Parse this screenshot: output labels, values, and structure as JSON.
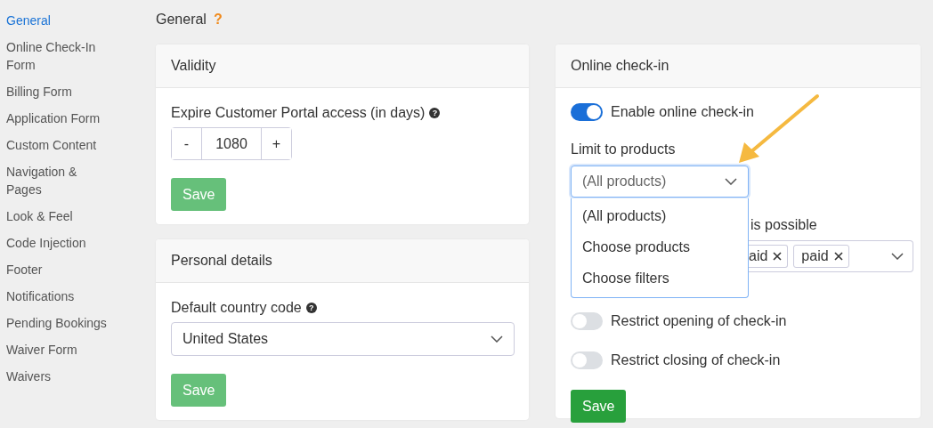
{
  "sidebar": {
    "items": [
      {
        "label": "General",
        "selected": true
      },
      {
        "label": "Online Check-In Form",
        "selected": false
      },
      {
        "label": "Billing Form",
        "selected": false
      },
      {
        "label": "Application Form",
        "selected": false
      },
      {
        "label": "Custom Content",
        "selected": false
      },
      {
        "label": "Navigation & Pages",
        "selected": false
      },
      {
        "label": "Look & Feel",
        "selected": false
      },
      {
        "label": "Code Injection",
        "selected": false
      },
      {
        "label": "Footer",
        "selected": false
      },
      {
        "label": "Notifications",
        "selected": false
      },
      {
        "label": "Pending Bookings",
        "selected": false
      },
      {
        "label": "Waiver Form",
        "selected": false
      },
      {
        "label": "Waivers",
        "selected": false
      }
    ]
  },
  "page_title": "General",
  "page_help": "?",
  "validity": {
    "title": "Validity",
    "field_label": "Expire Customer Portal access (in days)",
    "help": "?",
    "stepper": {
      "minus": "-",
      "value": "1080",
      "plus": "+"
    },
    "save": {
      "label": "Save",
      "disabled": true
    }
  },
  "personal_details": {
    "title": "Personal details",
    "field_label": "Default country code",
    "help": "?",
    "value": "United States",
    "save": {
      "label": "Save",
      "disabled": true
    }
  },
  "online_checkin": {
    "title": "Online check-in",
    "enable": {
      "label": "Enable online check-in",
      "on": true
    },
    "limit": {
      "label": "Limit to products",
      "value": "(All products)",
      "expanded": true,
      "options": [
        "(All products)",
        "Choose products",
        "Choose filters"
      ]
    },
    "partial_label": "is possible",
    "tags": [
      "aid",
      "paid"
    ],
    "restrictions": [
      {
        "label": "Restrict opening of check-in",
        "on": false
      },
      {
        "label": "Restrict closing of check-in",
        "on": false
      }
    ],
    "save": {
      "label": "Save",
      "disabled": false
    }
  }
}
